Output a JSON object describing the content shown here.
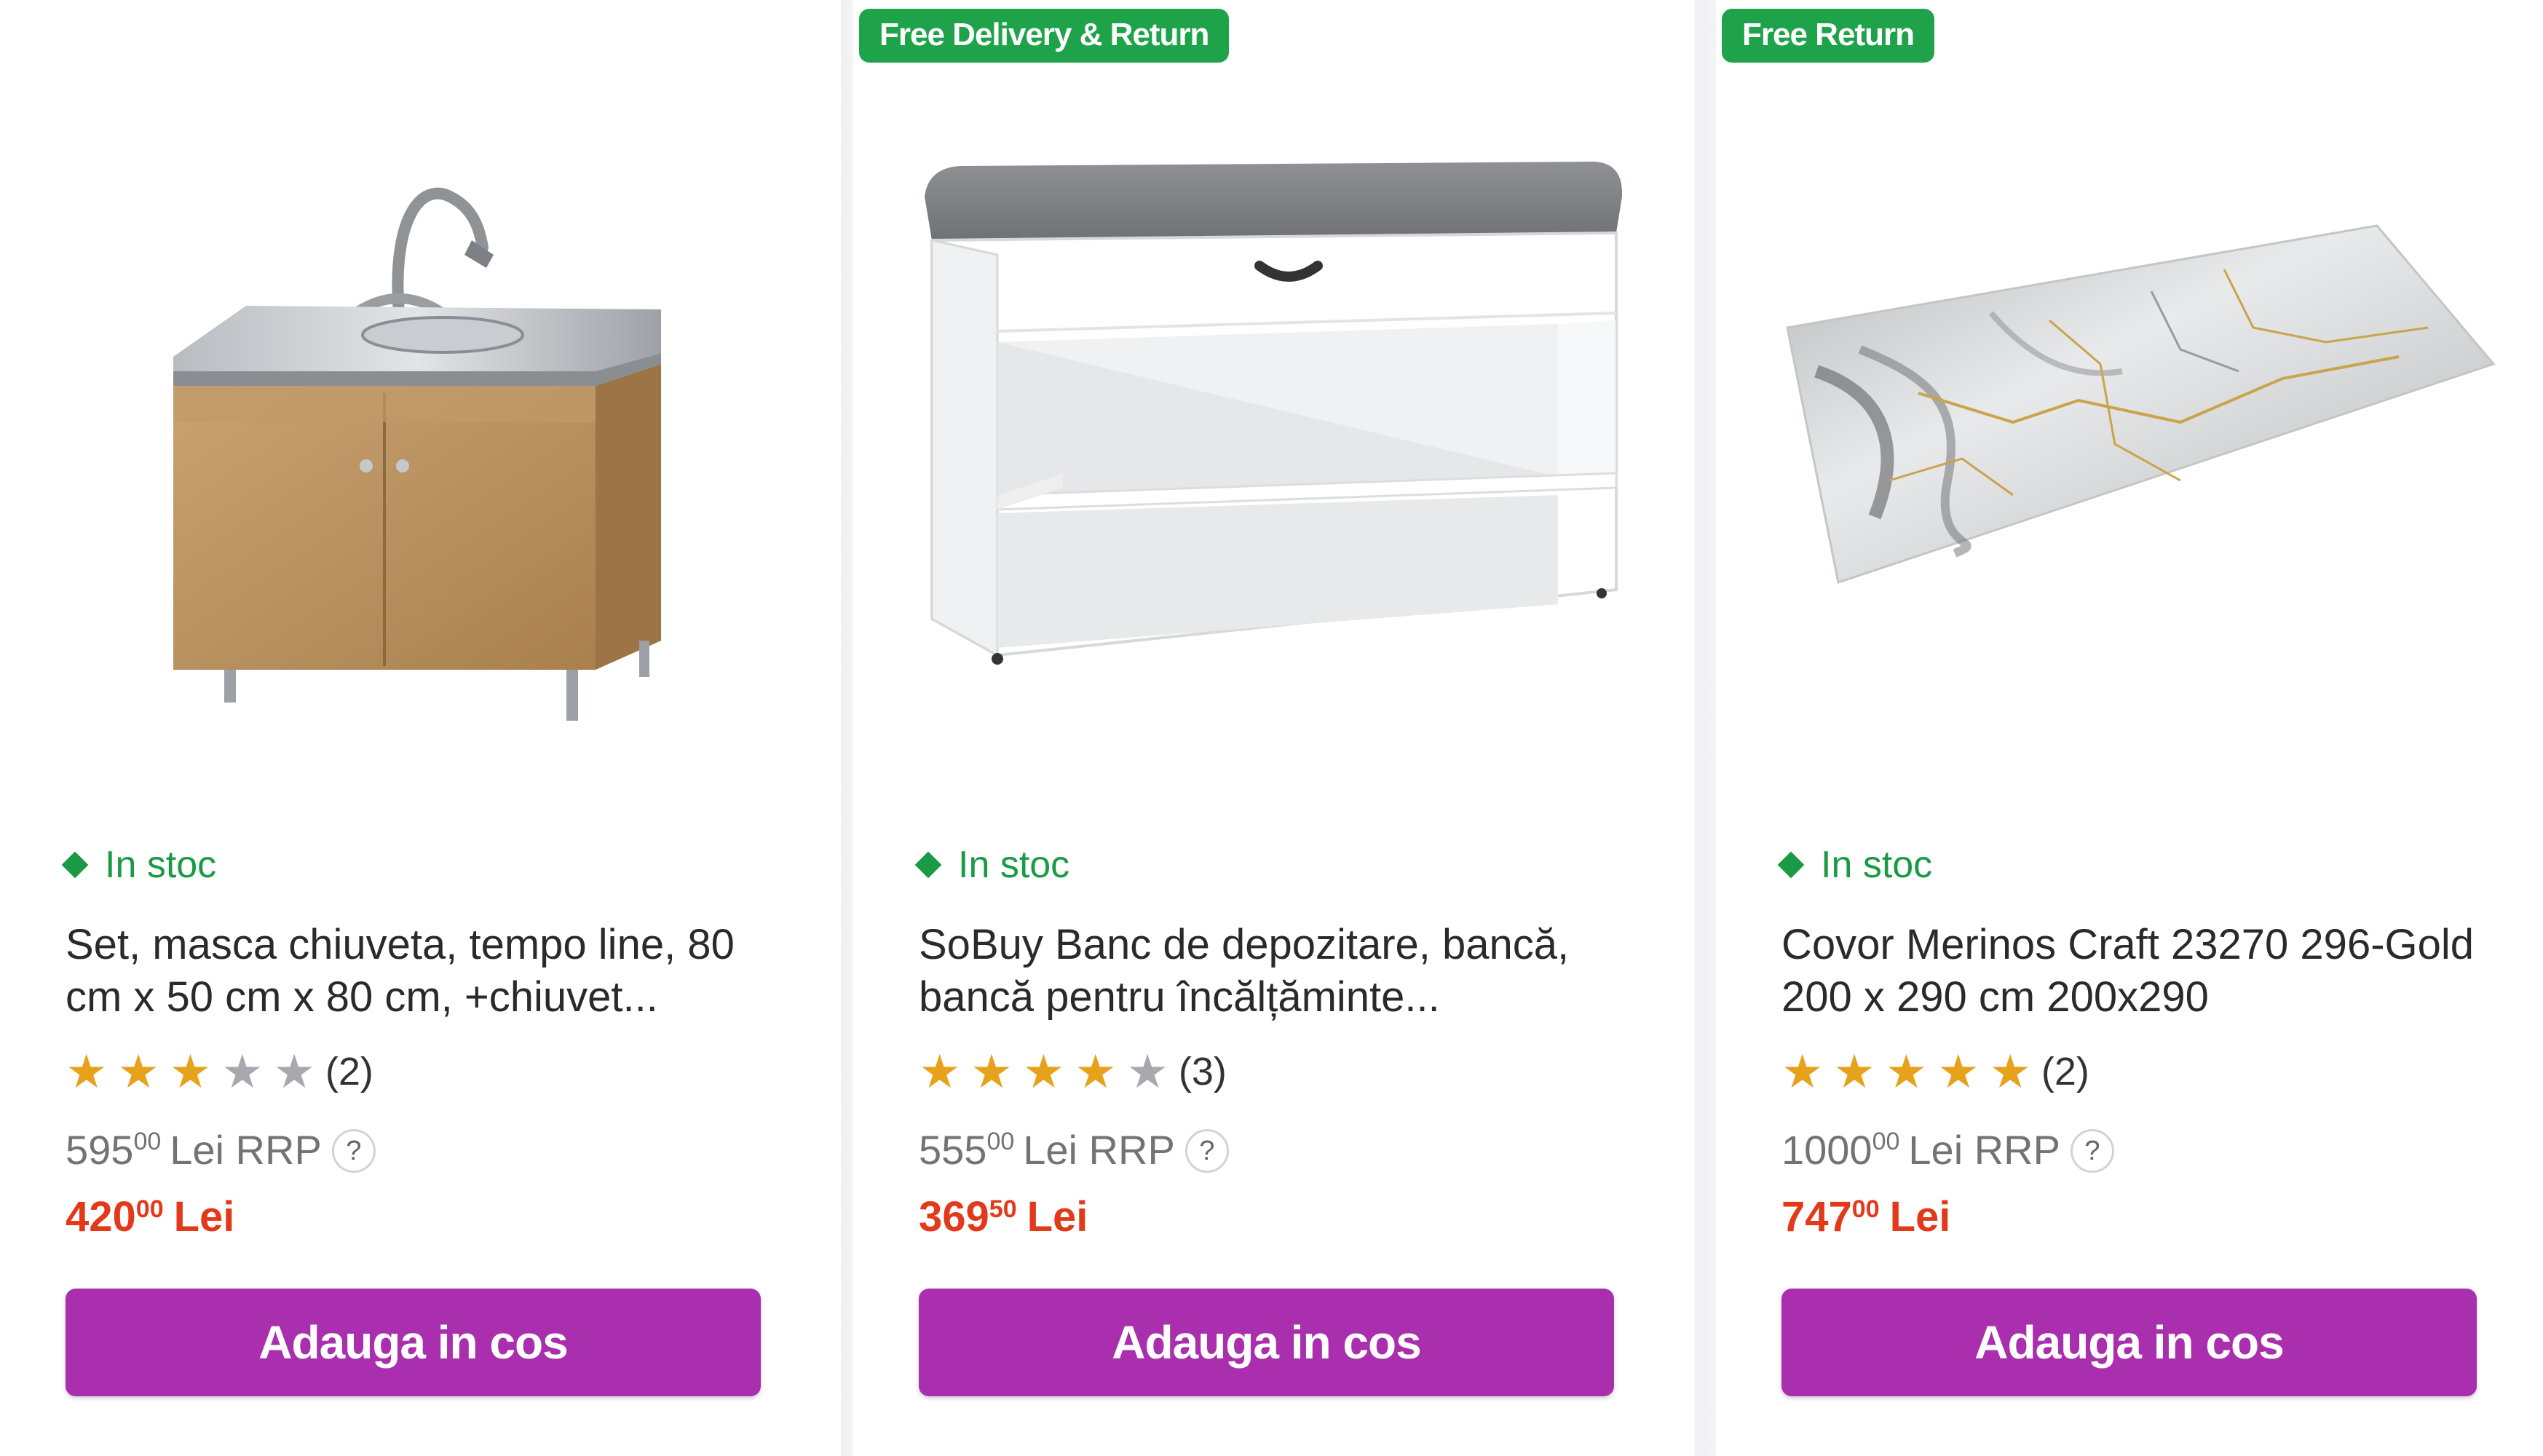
{
  "colors": {
    "stock_green": "#1b9a45",
    "badge_green": "#1fa34a",
    "sale_red": "#e2391b",
    "button_purple": "#a92fae",
    "star_gold": "#e7a21c",
    "star_gray": "#a7a9ae"
  },
  "products": [
    {
      "badge": "",
      "image_icon": "kitchen-sink-cabinet",
      "stock": "In stoc",
      "title": "Set, masca chiuveta, tempo line, 80 cm x 50 cm x 80 cm, +chiuvet...",
      "rating": 3,
      "rating_count": "(2)",
      "rrp_int": "595",
      "rrp_dec": "00",
      "rrp_label": "Lei RRP",
      "help": "?",
      "price_int": "420",
      "price_dec": "00",
      "currency": "Lei",
      "button": "Adauga in cos"
    },
    {
      "badge": "Free Delivery & Return",
      "image_icon": "shoe-storage-bench",
      "stock": "In stoc",
      "title": "SoBuy Banc de depozitare, bancă, bancă pentru încălțăminte...",
      "rating": 4,
      "rating_count": "(3)",
      "rrp_int": "555",
      "rrp_dec": "00",
      "rrp_label": "Lei RRP",
      "help": "?",
      "price_int": "369",
      "price_dec": "50",
      "currency": "Lei",
      "button": "Adauga in cos"
    },
    {
      "badge": "Free Return",
      "image_icon": "marble-rug",
      "stock": "In stoc",
      "title": "Covor Merinos Craft 23270 296-Gold 200 x 290 cm 200x290",
      "rating": 5,
      "rating_count": "(2)",
      "rrp_int": "1000",
      "rrp_dec": "00",
      "rrp_label": "Lei RRP",
      "help": "?",
      "price_int": "747",
      "price_dec": "00",
      "currency": "Lei",
      "button": "Adauga in cos"
    }
  ]
}
